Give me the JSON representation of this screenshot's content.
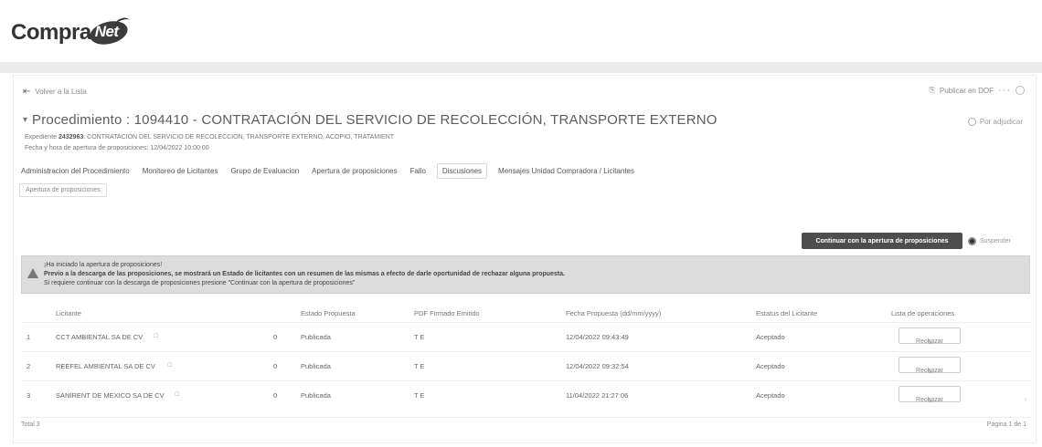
{
  "logo": {
    "compra": "Compra",
    "net": "Net"
  },
  "nav": {
    "back_label": "Volver a la Lista",
    "publish_label": "Publicar en DOF",
    "more": "···"
  },
  "procedure": {
    "title": "Procedimiento : 1094410 - CONTRATACIÓN DEL SERVICIO DE RECOLECCIÓN, TRANSPORTE EXTERNO",
    "status": "Por adjudicar",
    "expediente_label": "Expediente",
    "expediente_number": "2432963",
    "expediente_desc": ": CONTRATACION DEL SERVICIO DE RECOLECCION, TRANSPORTE EXTERNO, ACOPIO, TRATAMIENT",
    "date_line": "Fecha y hora de apertura de proposiciones: 12/04/2022 10:00:00"
  },
  "tabs": [
    {
      "label": "Administracion del Procedimiento"
    },
    {
      "label": "Monitoreo de Licitantes"
    },
    {
      "label": "Grupo de Evaluacion"
    },
    {
      "label": "Apertura de proposiciones"
    },
    {
      "label": "Fallo"
    },
    {
      "label": "Discusiones"
    },
    {
      "label": "Mensajes Unidad Compradora / Licitantes"
    }
  ],
  "sub_tab": "Apertura de proposiciones",
  "actions": {
    "continue_label": "Continuar con la apertura de proposiciones",
    "suspend_label": "Suspender"
  },
  "alert": {
    "line1": "¡Ha iniciado la apertura de proposiciones!",
    "line2": "Previo a la descarga de las proposiciones, se mostrará un Estado de licitantes con un resumen de las mismas a efecto de darle oportunidad de rechazar alguna propuesta.",
    "line3": "Si requiere continuar con la descarga de proposiciones presione \"Continuar con la apertura de proposiciones\""
  },
  "table": {
    "headers": {
      "licitante": "Licitante",
      "estado": "Estado Propuesta",
      "pdf": "PDF Firmado Emitido",
      "fecha": "Fecha Propuesta (dd/mm/yyyy)",
      "estatus": "Estatus del Licitante",
      "ops": "Lista de operaciones"
    },
    "rows": [
      {
        "num": "1",
        "licitante": "CCT AMBIENTAL SA DE CV",
        "ext": "☐",
        "count": "0",
        "estado": "Publicada",
        "pdf": "T E",
        "fecha": "12/04/2022 09:43:49",
        "estatus": "Aceptado",
        "action": "Rechazar"
      },
      {
        "num": "2",
        "licitante": "REEFEL AMBIENTAL SA DE CV",
        "ext": "☐",
        "count": "0",
        "estado": "Publicada",
        "pdf": "T E",
        "fecha": "12/04/2022 09:32:54",
        "estatus": "Aceptado",
        "action": "Rechazar"
      },
      {
        "num": "3",
        "licitante": "SANIRENT DE MEXICO SA DE CV",
        "ext": "☐",
        "count": "0",
        "estado": "Publicada",
        "pdf": "T E",
        "fecha": "11/04/2022 21:27:06",
        "estatus": "Aceptado",
        "action": "Rechazar"
      }
    ]
  },
  "footer": {
    "total": "Total 3",
    "page": "Página 1 de 1"
  }
}
